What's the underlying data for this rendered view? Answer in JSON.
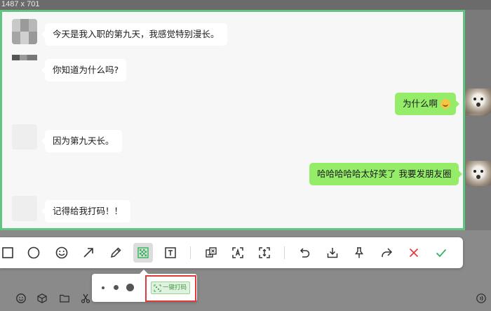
{
  "screen_size_label": "1487 x 701",
  "chat": {
    "messages": [
      {
        "side": "in",
        "text": "今天是我入职的第九天，我感觉特别漫长。"
      },
      {
        "side": "in",
        "text": "你知道为什么吗?"
      },
      {
        "side": "out",
        "text": "为什么啊"
      },
      {
        "side": "in",
        "text": "因为第九天长。"
      },
      {
        "side": "out",
        "text": "哈哈哈哈哈太好笑了 我要发朋友圈"
      },
      {
        "side": "in",
        "text": "记得给我打码！！"
      }
    ],
    "selection_border_color": "#5fc580",
    "outgoing_bubble_color": "#95ec69"
  },
  "toolbar": {
    "tools": [
      {
        "name": "rectangle-tool",
        "icon": "rectangle-icon"
      },
      {
        "name": "ellipse-tool",
        "icon": "circle-icon"
      },
      {
        "name": "emoji-tool",
        "icon": "emoji-icon"
      },
      {
        "name": "arrow-tool",
        "icon": "arrow-icon"
      },
      {
        "name": "pen-tool",
        "icon": "pen-icon"
      },
      {
        "name": "mosaic-tool",
        "icon": "mosaic-icon",
        "active": true
      },
      {
        "name": "text-tool",
        "icon": "text-icon"
      },
      {
        "name": "translate-tool",
        "icon": "translate-icon"
      },
      {
        "name": "ocr-tool",
        "icon": "ocr-icon"
      },
      {
        "name": "long-screenshot-tool",
        "icon": "scroll-capture-icon"
      },
      {
        "name": "undo-tool",
        "icon": "undo-icon"
      },
      {
        "name": "save-tool",
        "icon": "download-icon"
      },
      {
        "name": "pin-tool",
        "icon": "pin-icon"
      },
      {
        "name": "share-tool",
        "icon": "share-icon"
      },
      {
        "name": "cancel-tool",
        "icon": "close-icon"
      },
      {
        "name": "confirm-tool",
        "icon": "check-icon"
      }
    ],
    "cancel_color": "#e0393e",
    "confirm_color": "#2fb45a"
  },
  "mosaic_panel": {
    "brush_sizes": [
      "small",
      "medium",
      "large"
    ],
    "one_key_mosaic_label": "一键打码",
    "highlight_color": "#e0393e"
  },
  "input_bar": {
    "icons": [
      "emoji-icon",
      "box-icon",
      "folder-icon",
      "scissors-icon",
      "voice-icon"
    ]
  }
}
